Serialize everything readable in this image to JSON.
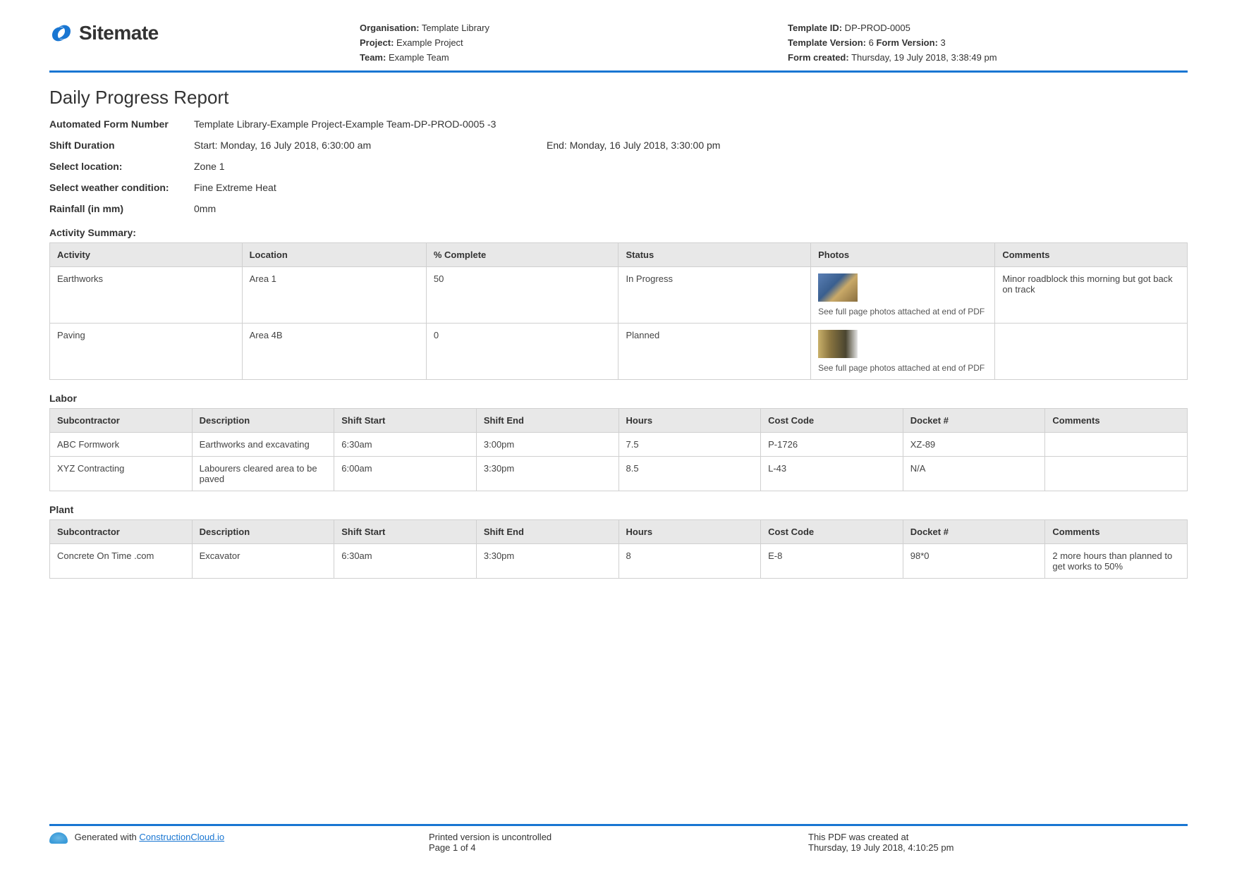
{
  "brand": "Sitemate",
  "header_meta1": {
    "organisation_label": "Organisation:",
    "organisation": " Template Library",
    "project_label": "Project:",
    "project": " Example Project",
    "team_label": "Team:",
    "team": " Example Team"
  },
  "header_meta2": {
    "template_id_label": "Template ID:",
    "template_id": " DP-PROD-0005",
    "template_version_label": "Template Version:",
    "template_version": " 6 ",
    "form_version_label": "Form Version:",
    "form_version": " 3",
    "form_created_label": "Form created:",
    "form_created": " Thursday, 19 July 2018, 3:38:49 pm"
  },
  "title": "Daily Progress Report",
  "fields": {
    "afn_label": "Automated Form Number",
    "afn_value": "Template Library-Example Project-Example Team-DP-PROD-0005   -3",
    "shift_label": "Shift Duration",
    "shift_start": "Start: Monday, 16 July 2018, 6:30:00 am",
    "shift_end": "End: Monday, 16 July 2018, 3:30:00 pm",
    "location_label": "Select location:",
    "location_value": "Zone 1",
    "weather_label": "Select weather condition:",
    "weather_value": "Fine   Extreme Heat",
    "rainfall_label": "Rainfall (in mm)",
    "rainfall_value": "0mm"
  },
  "activity": {
    "section": "Activity Summary:",
    "headers": [
      "Activity",
      "Location",
      "% Complete",
      "Status",
      "Photos",
      "Comments"
    ],
    "photo_note": "See full page photos attached at end of PDF",
    "rows": [
      {
        "activity": "Earthworks",
        "location": "Area 1",
        "complete": "50",
        "status": "In Progress",
        "comments": "Minor roadblock this morning but got back on track"
      },
      {
        "activity": "Paving",
        "location": "Area 4B",
        "complete": "0",
        "status": "Planned",
        "comments": ""
      }
    ]
  },
  "labor": {
    "section": "Labor",
    "headers": [
      "Subcontractor",
      "Description",
      "Shift Start",
      "Shift End",
      "Hours",
      "Cost Code",
      "Docket #",
      "Comments"
    ],
    "rows": [
      {
        "sub": "ABC Formwork",
        "desc": "Earthworks and excavating",
        "start": "6:30am",
        "end": "3:00pm",
        "hours": "7.5",
        "code": "P-1726",
        "docket": "XZ-89",
        "comments": ""
      },
      {
        "sub": "XYZ Contracting",
        "desc": "Labourers cleared area to be paved",
        "start": "6:00am",
        "end": "3:30pm",
        "hours": "8.5",
        "code": "L-43",
        "docket": "N/A",
        "comments": ""
      }
    ]
  },
  "plant": {
    "section": "Plant",
    "headers": [
      "Subcontractor",
      "Description",
      "Shift Start",
      "Shift End",
      "Hours",
      "Cost Code",
      "Docket #",
      "Comments"
    ],
    "rows": [
      {
        "sub": "Concrete On Time .com",
        "desc": "Excavator",
        "start": "6:30am",
        "end": "3:30pm",
        "hours": "8",
        "code": "E-8",
        "docket": "98*0",
        "comments": "2 more hours than planned to get works to 50%"
      }
    ]
  },
  "footer": {
    "generated_prefix": "Generated with ",
    "generated_link": "ConstructionCloud.io",
    "uncontrolled": "Printed version is uncontrolled",
    "page": "Page 1 of 4",
    "created_label": "This PDF was created at",
    "created_ts": "Thursday, 19 July 2018, 4:10:25 pm"
  }
}
